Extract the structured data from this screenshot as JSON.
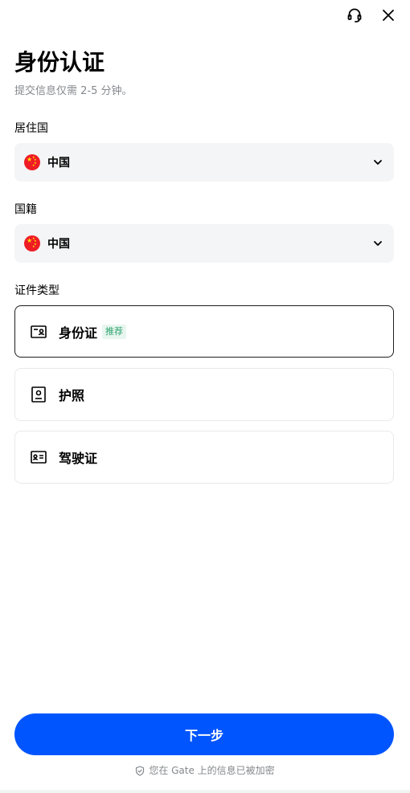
{
  "header": {
    "title": "身份认证",
    "subtitle": "提交信息仅需 2-5 分钟。"
  },
  "residence": {
    "label": "居住国",
    "value": "中国"
  },
  "nationality": {
    "label": "国籍",
    "value": "中国"
  },
  "document_type": {
    "label": "证件类型",
    "options": [
      {
        "label": "身份证",
        "badge": "推荐",
        "selected": true
      },
      {
        "label": "护照",
        "selected": false
      },
      {
        "label": "驾驶证",
        "selected": false
      }
    ]
  },
  "actions": {
    "next_label": "下一步"
  },
  "footer": {
    "note": "您在 Gate 上的信息已被加密"
  },
  "colors": {
    "primary": "#0055ff",
    "badge_text": "#2ea46e",
    "muted_text": "#84888c",
    "field_bg": "#f4f5f6"
  },
  "icons": {
    "top_left": "headset-icon",
    "top_right": "close-icon"
  }
}
